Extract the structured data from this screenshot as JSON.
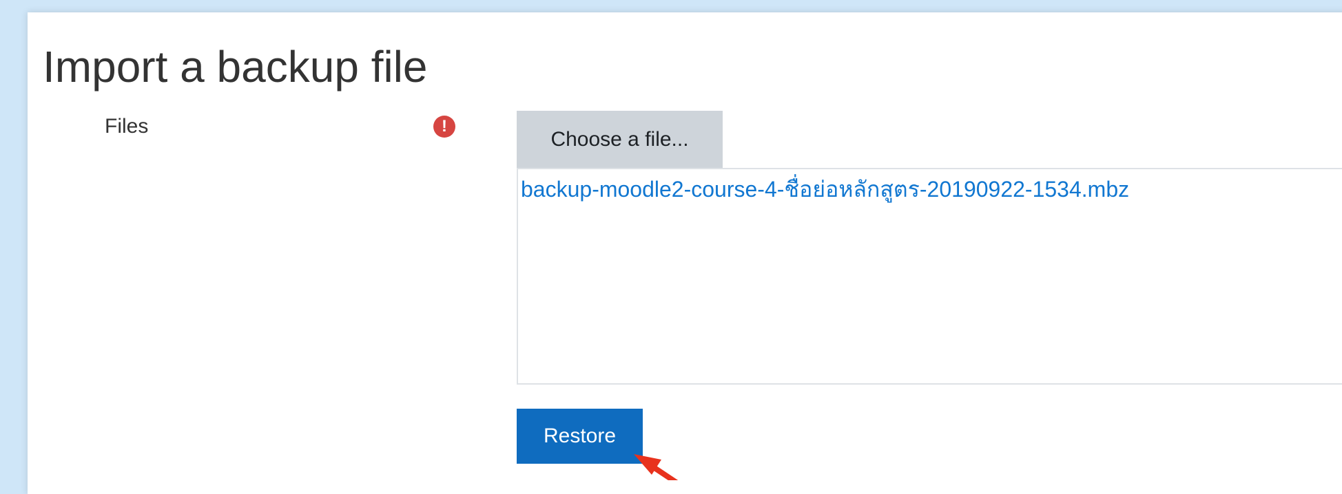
{
  "page": {
    "title": "Import a backup file"
  },
  "form": {
    "files_label": "Files",
    "required_icon": "exclamation-circle-icon",
    "choose_file_label": "Choose a file...",
    "selected_file": "backup-moodle2-course-4-ชื่อย่อหลักสูตร-20190922-1534.mbz",
    "restore_label": "Restore"
  },
  "colors": {
    "background": "#cfe6f8",
    "primary": "#0f6cbf",
    "link": "#1177d1",
    "required": "#d64541",
    "secondary_button": "#ced4da",
    "annotation_arrow": "#e8321d"
  }
}
